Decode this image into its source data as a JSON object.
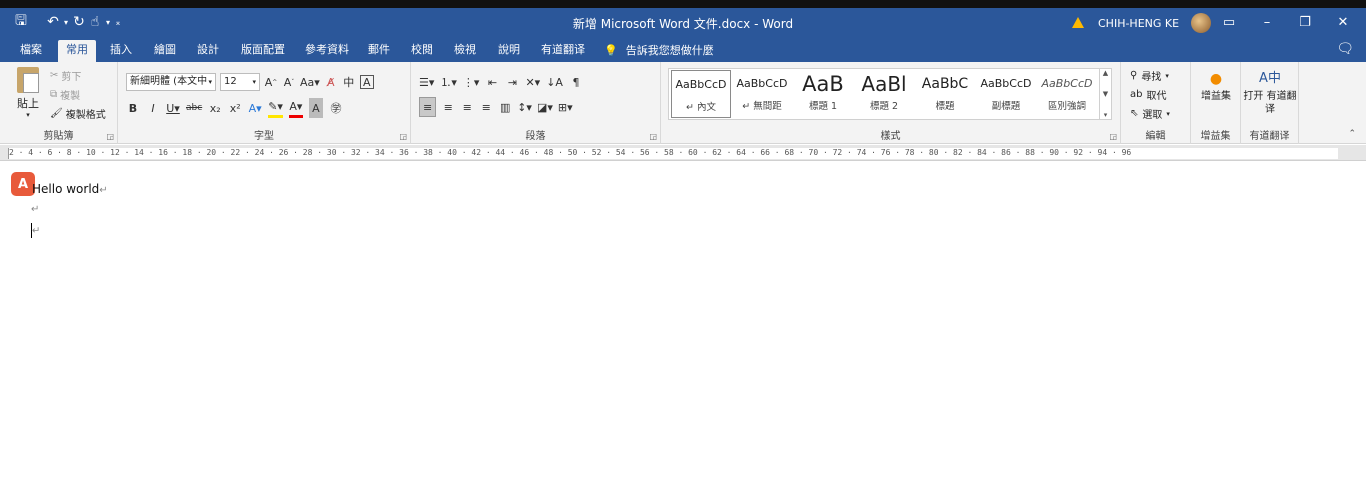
{
  "app": {
    "title": "新增 Microsoft Word 文件.docx - Word",
    "user": "CHIH-HENG KE"
  },
  "quick_access": {
    "save_icon": "save-icon",
    "undo_icon": "undo-icon",
    "redo_icon": "redo-icon",
    "touch_icon": "touch-mode-icon"
  },
  "tabs": [
    "檔案",
    "常用",
    "插入",
    "繪圖",
    "設計",
    "版面配置",
    "參考資料",
    "郵件",
    "校閱",
    "檢視",
    "說明",
    "有道翻译"
  ],
  "active_tab": "常用",
  "tellme": "告訴我您想做什麼",
  "ribbon": {
    "clipboard": {
      "paste": "貼上",
      "cut": "剪下",
      "copy": "複製",
      "format_painter": "複製格式",
      "label": "剪貼簿"
    },
    "font": {
      "font_name": "新細明體 (本文中",
      "font_size": "12",
      "label": "字型"
    },
    "paragraph": {
      "label": "段落"
    },
    "styles": {
      "items": [
        {
          "sample": "AaBbCcD",
          "name": "↵ 內文"
        },
        {
          "sample": "AaBbCcD",
          "name": "↵ 無間距"
        },
        {
          "sample": "AaB",
          "name": "標題 1"
        },
        {
          "sample": "AaBl",
          "name": "標題 2"
        },
        {
          "sample": "AaBbC",
          "name": "標題"
        },
        {
          "sample": "AaBbCcD",
          "name": "副標題"
        },
        {
          "sample": "AaBbCcD",
          "name": "區別強調"
        }
      ],
      "label": "樣式"
    },
    "editing": {
      "find": "尋找",
      "replace": "取代",
      "select": "選取",
      "label": "編輯"
    },
    "addin": {
      "button": "增益集",
      "label": "增益集"
    },
    "translate": {
      "button": "打开 有道翻译",
      "label": "有道翻译"
    }
  },
  "ruler": {
    "ticks": "2 · 4 · 6 · 8 · 10 · 12 · 14 · 16 · 18 · 20 · 22 · 24 · 26 · 28 · 30 · 32 · 34 · 36 · 38 · 40 · 42 · 44 · 46 · 48 · 50 · 52 · 54 · 56 · 58 · 60 · 62 · 64 · 66 · 68 · 70 · 72 · 74 · 76 · 78 · 80 · 82 · 84 · 86 · 88 · 90 · 92 · 94 · 96"
  },
  "document": {
    "line1": "Hello world",
    "paragraph_mark": "↵"
  }
}
